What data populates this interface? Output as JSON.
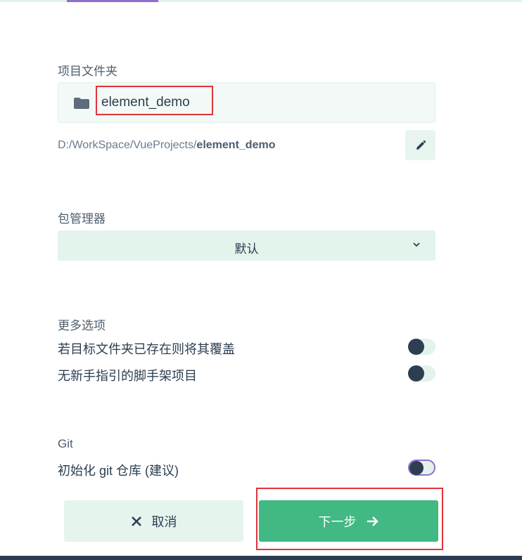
{
  "project_folder": {
    "label": "项目文件夹",
    "name": "element_demo",
    "path_prefix": "D:/WorkSpace/VueProjects/",
    "path_name": "element_demo"
  },
  "package_manager": {
    "label": "包管理器",
    "value": "默认"
  },
  "more_options": {
    "label": "更多选项",
    "items": [
      {
        "label": "若目标文件夹已存在则将其覆盖",
        "enabled": false
      },
      {
        "label": "无新手指引的脚手架项目",
        "enabled": false
      }
    ]
  },
  "git": {
    "label": "Git",
    "items": [
      {
        "label": "初始化 git 仓库 (建议)",
        "enabled": false
      }
    ]
  },
  "footer": {
    "cancel_label": "取消",
    "next_label": "下一步"
  },
  "colors": {
    "accent": "#42b883",
    "text_dark": "#2c3e50",
    "highlight_box": "#e0343a",
    "focus_ring": "#8e6fcf"
  }
}
